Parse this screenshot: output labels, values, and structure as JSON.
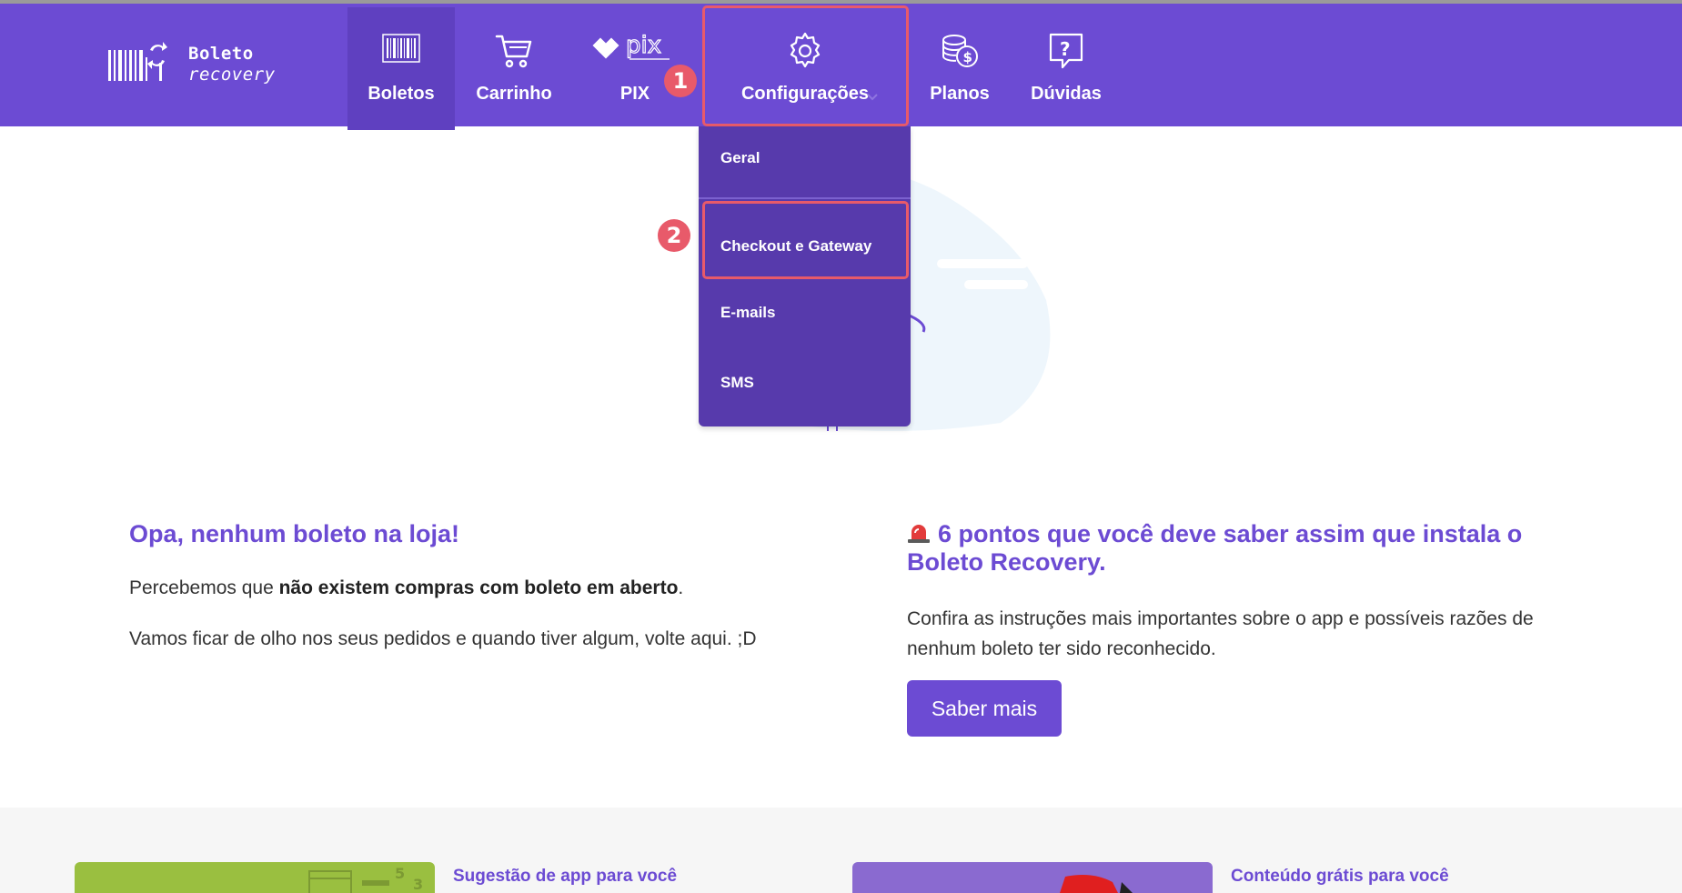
{
  "brand": {
    "line1": "Boleto",
    "line2": "recovery"
  },
  "nav": {
    "boletos": "Boletos",
    "carrinho": "Carrinho",
    "pix": "PIX",
    "configuracoes": "Configurações",
    "planos": "Planos",
    "duvidas": "Dúvidas"
  },
  "dropdown": {
    "items": [
      "Geral",
      "Checkout e Gateway",
      "E-mails",
      "SMS"
    ]
  },
  "badges": {
    "step1": "1",
    "step2": "2"
  },
  "empty": {
    "title": "Opa, nenhum boleto na loja!",
    "text1_pre": "Percebemos que ",
    "text1_bold": "não existem compras com boleto em aberto",
    "text1_post": ".",
    "text2": "Vamos ficar de olho nos seus pedidos e quando tiver algum, volte aqui. ;D"
  },
  "tips": {
    "title": "6 pontos que você deve saber assim que instala o Boleto Recovery.",
    "text": "Confira as instruções mais importantes sobre o app e possíveis razões de nenhum boleto ter sido reconhecido.",
    "button": "Saber mais"
  },
  "promos": {
    "label1": "Sugestão de app para você",
    "label2": "Conteúdo grátis para você"
  },
  "colors": {
    "brand": "#6c4bd3",
    "dropdown_bg": "#573aac",
    "highlight": "#e85a6a",
    "promo_green": "#9abf40"
  }
}
